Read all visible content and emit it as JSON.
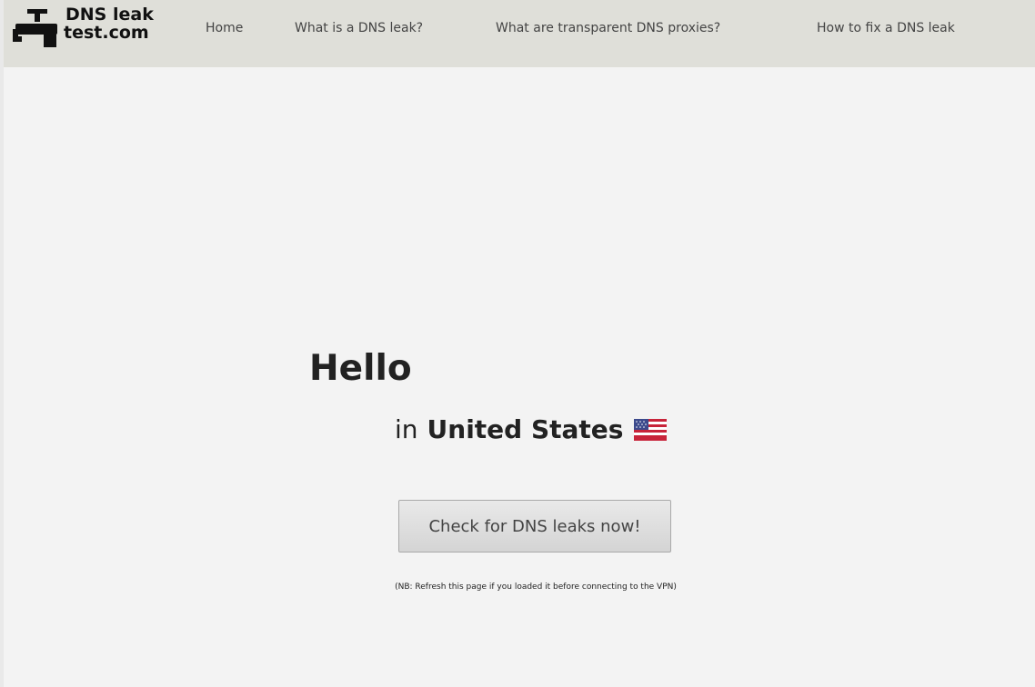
{
  "logo": {
    "line1": "DNS leak",
    "line2": "test.com",
    "icon": "water-tap-icon"
  },
  "nav": [
    {
      "label": "Home"
    },
    {
      "label": "What is a DNS leak?"
    },
    {
      "label": "What are transparent DNS proxies?"
    },
    {
      "label": "How to fix a DNS leak"
    }
  ],
  "main": {
    "greeting": "Hello",
    "location_prefix": "in",
    "country": "United States",
    "flag_icon": "us-flag-icon",
    "check_button": "Check for DNS leaks now!",
    "note": "(NB: Refresh this page if you loaded it before connecting to the VPN)"
  },
  "colors": {
    "navbar_bg": "#dfdfd9",
    "page_bg": "#f3f3f3",
    "button_border": "#a9a9a9"
  }
}
